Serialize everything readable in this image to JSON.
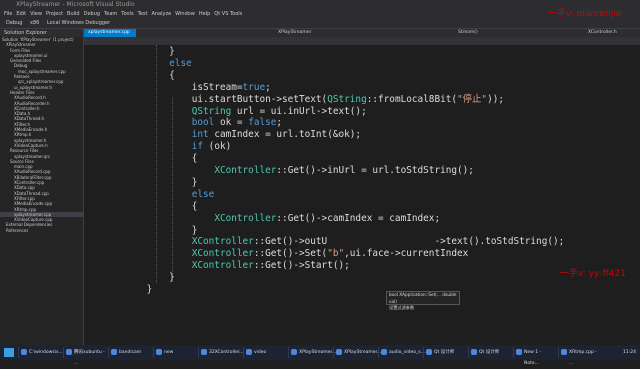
{
  "window": {
    "title": "XPlayStreamer - Microsoft Visual Studio"
  },
  "menu": {
    "items": [
      "File",
      "Edit",
      "View",
      "Project",
      "Build",
      "Debug",
      "Team",
      "Tools",
      "Test",
      "Analyze",
      "Window",
      "Help",
      "Qt VS Tools"
    ]
  },
  "toolbar": {
    "config": "Debug",
    "platform": "x86",
    "run_label": "Local Windows Debugger"
  },
  "solution_explorer": {
    "header": "Solution Explorer",
    "items": [
      "Solution 'XPlayStreamer' (1 project)",
      "XPlayStreamer",
      "Form Files",
      "xplaystreamer.ui",
      "Generated Files",
      "Debug",
      "moc_xplaystreamer.cpp",
      "Release",
      "qrc_xplaystreamer.cpp",
      "ui_xplaystreamer.h",
      "Header Files",
      "XAudioRecord.h",
      "XAudioRecorder.h",
      "XController.h",
      "XData.h",
      "XDataThread.h",
      "XFilter.h",
      "XMediaEncode.h",
      "XRtmp.h",
      "xplaystreamer.h",
      "XVideoCapture.h",
      "Resource Files",
      "xplaystreamer.qrc",
      "Source Files",
      "main.cpp",
      "XAudioRecord.cpp",
      "XBilateralFilter.cpp",
      "XController.cpp",
      "XData.cpp",
      "XDataThread.cpp",
      "XFilter.cpp",
      "XMediaEncode.cpp",
      "XRtmp.cpp",
      "xplaystreamer.cpp",
      "XVideoCapture.cpp",
      "External Dependencies",
      "References"
    ],
    "selected_index": 33
  },
  "tabs": [
    {
      "label": "xplaystreamer.cpp",
      "active": true
    },
    {
      "label": "XPlayStreamer",
      "active": false
    },
    {
      "label": "Stream()",
      "active": false
    },
    {
      "label": "XController.h",
      "active": false
    }
  ],
  "code_lines": [
    [
      {
        "t": "        }",
        "c": ""
      }
    ],
    [
      {
        "t": "        ",
        "c": ""
      },
      {
        "t": "else",
        "c": "kw"
      }
    ],
    [
      {
        "t": "        {",
        "c": ""
      }
    ],
    [
      {
        "t": "            isStream=",
        "c": ""
      },
      {
        "t": "true",
        "c": "kw"
      },
      {
        "t": ";",
        "c": ""
      }
    ],
    [
      {
        "t": "            ui.startButton->setText(",
        "c": ""
      },
      {
        "t": "QString",
        "c": "ty"
      },
      {
        "t": "::fromLocal8Bit(",
        "c": ""
      },
      {
        "t": "\"停止\"",
        "c": "str"
      },
      {
        "t": "));",
        "c": ""
      }
    ],
    [
      {
        "t": "            ",
        "c": ""
      },
      {
        "t": "QString",
        "c": "ty"
      },
      {
        "t": " url = ui.inUrl->text();",
        "c": ""
      }
    ],
    [
      {
        "t": "            ",
        "c": ""
      },
      {
        "t": "bool",
        "c": "kw"
      },
      {
        "t": " ok = ",
        "c": ""
      },
      {
        "t": "false",
        "c": "kw"
      },
      {
        "t": ";",
        "c": ""
      }
    ],
    [
      {
        "t": "            ",
        "c": ""
      },
      {
        "t": "int",
        "c": "kw"
      },
      {
        "t": " camIndex = url.toInt(&ok);",
        "c": ""
      }
    ],
    [
      {
        "t": "            ",
        "c": ""
      },
      {
        "t": "if",
        "c": "kw"
      },
      {
        "t": " (ok)",
        "c": ""
      }
    ],
    [
      {
        "t": "            {",
        "c": ""
      }
    ],
    [
      {
        "t": "                ",
        "c": ""
      },
      {
        "t": "XController",
        "c": "ty"
      },
      {
        "t": "::Get()->inUrl = url.toStdString();",
        "c": ""
      }
    ],
    [
      {
        "t": "            }",
        "c": ""
      }
    ],
    [
      {
        "t": "            ",
        "c": ""
      },
      {
        "t": "else",
        "c": "kw"
      }
    ],
    [
      {
        "t": "            {",
        "c": ""
      }
    ],
    [
      {
        "t": "                ",
        "c": ""
      },
      {
        "t": "XController",
        "c": "ty"
      },
      {
        "t": "::Get()->camIndex = camIndex;",
        "c": ""
      }
    ],
    [
      {
        "t": "            }",
        "c": ""
      }
    ],
    [
      {
        "t": "            ",
        "c": ""
      },
      {
        "t": "XController",
        "c": "ty"
      },
      {
        "t": "::Get()->outU",
        "c": ""
      },
      {
        "t": "                   ",
        "c": ""
      },
      {
        "t": "->text().toStdString();",
        "c": ""
      }
    ],
    [
      {
        "t": "            ",
        "c": ""
      },
      {
        "t": "XController",
        "c": "ty"
      },
      {
        "t": "::Get()->Set(",
        "c": ""
      },
      {
        "t": "\"b\"",
        "c": "str"
      },
      {
        "t": ",ui.face->currentIndex",
        "c": ""
      }
    ],
    [
      {
        "t": "            ",
        "c": ""
      },
      {
        "t": "XController",
        "c": "ty"
      },
      {
        "t": "::Get()->Start();",
        "c": ""
      }
    ],
    [
      {
        "t": "        }",
        "c": ""
      }
    ],
    [
      {
        "t": "    }",
        "c": ""
      }
    ]
  ],
  "tooltip": {
    "line1": "bool XApplication::Set(... double val)",
    "line2": "设置过滤参数"
  },
  "watermarks": {
    "top": "一手v: qianrenjie",
    "right": "一手v: yy-ff421"
  },
  "taskbar": {
    "items": [
      "C:\\windows\\s...",
      "腾讯xubuntu - ...",
      "bandicam",
      "new",
      "32XController...",
      "video",
      "XPlayStreamer...",
      "XPlayStreamer...",
      "audio_video_s...",
      "Qt 设计师",
      "Qt 设计师",
      "New 1 - Note...",
      "XRtmp.cpp - ..."
    ],
    "clock": "11:24"
  }
}
